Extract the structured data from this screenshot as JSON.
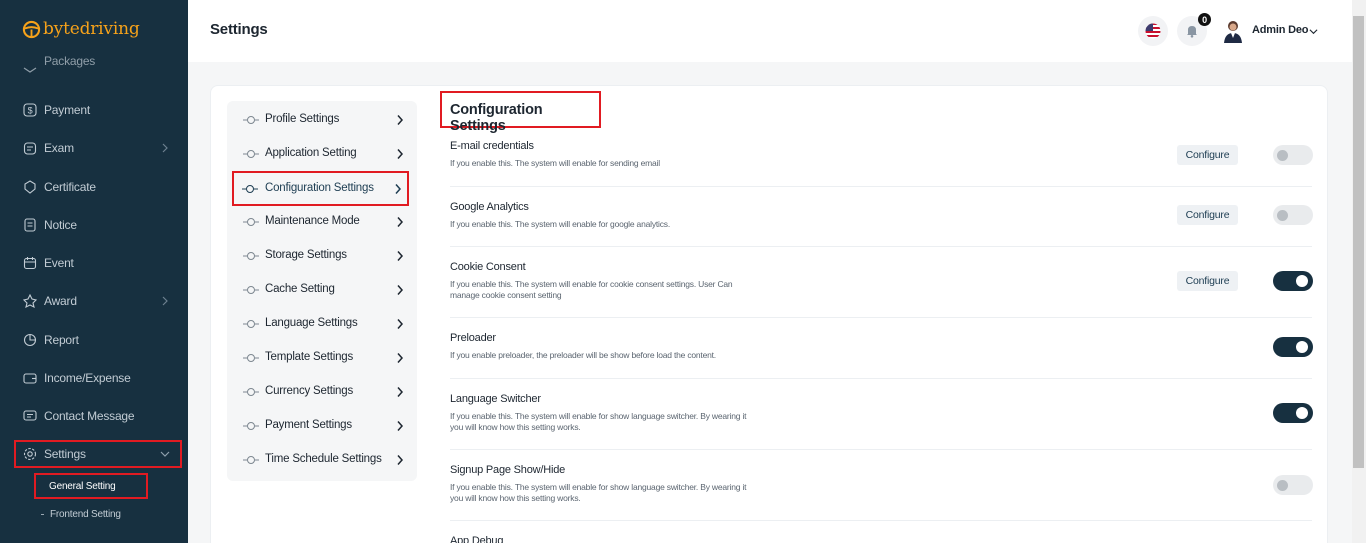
{
  "app": {
    "name": "bytedriving",
    "brand_color": "#f6a21a",
    "sidebar_bg": "#173040"
  },
  "sidebar": {
    "partial_item": "Packages",
    "items": [
      {
        "label": "Payment",
        "icon": "dollar-icon"
      },
      {
        "label": "Exam",
        "icon": "exam-icon",
        "has_children": true
      },
      {
        "label": "Certificate",
        "icon": "certificate-icon"
      },
      {
        "label": "Notice",
        "icon": "notice-icon"
      },
      {
        "label": "Event",
        "icon": "calendar-icon"
      },
      {
        "label": "Award",
        "icon": "award-icon",
        "has_children": true
      },
      {
        "label": "Report",
        "icon": "report-icon"
      },
      {
        "label": "Income/Expense",
        "icon": "wallet-icon"
      },
      {
        "label": "Contact Message",
        "icon": "message-icon"
      },
      {
        "label": "Settings",
        "icon": "gear-icon",
        "expanded": true,
        "active": true
      }
    ],
    "subitems": [
      {
        "label": "General Setting",
        "active": true
      },
      {
        "label": "Frontend Setting"
      }
    ]
  },
  "header": {
    "title": "Settings",
    "notifications_count": "0",
    "user_name": "Admin Deo",
    "language_flag": "us-flag-icon"
  },
  "settings_menu": [
    {
      "label": "Profile Settings"
    },
    {
      "label": "Application Setting"
    },
    {
      "label": "Configuration Settings",
      "active": true
    },
    {
      "label": "Maintenance Mode"
    },
    {
      "label": "Storage Settings"
    },
    {
      "label": "Cache Setting"
    },
    {
      "label": "Language Settings"
    },
    {
      "label": "Template Settings"
    },
    {
      "label": "Currency Settings"
    },
    {
      "label": "Payment Settings"
    },
    {
      "label": "Time Schedule Settings"
    }
  ],
  "config": {
    "title": "Configuration Settings",
    "configure_label": "Configure",
    "rows": [
      {
        "title": "E-mail credentials",
        "desc": "If you enable this. The system will enable for sending email",
        "configure": true,
        "enabled": false
      },
      {
        "title": "Google Analytics",
        "desc": "If you enable this. The system will enable for google analytics.",
        "configure": true,
        "enabled": false
      },
      {
        "title": "Cookie Consent",
        "desc": "If you enable this. The system will enable for cookie consent settings. User Can manage cookie consent setting",
        "configure": true,
        "enabled": true
      },
      {
        "title": "Preloader",
        "desc": "If you enable preloader, the preloader will be show before load the content.",
        "configure": false,
        "enabled": true
      },
      {
        "title": "Language Switcher",
        "desc": "If you enable this. The system will enable for show language switcher. By wearing it you will know how this setting works.",
        "configure": false,
        "enabled": true
      },
      {
        "title": "Signup Page Show/Hide",
        "desc": "If you enable this. The system will enable for show language switcher. By wearing it you will know how this setting works.",
        "configure": false,
        "enabled": false
      },
      {
        "title": "App Debug",
        "desc": "",
        "configure": false,
        "enabled": false
      }
    ]
  }
}
